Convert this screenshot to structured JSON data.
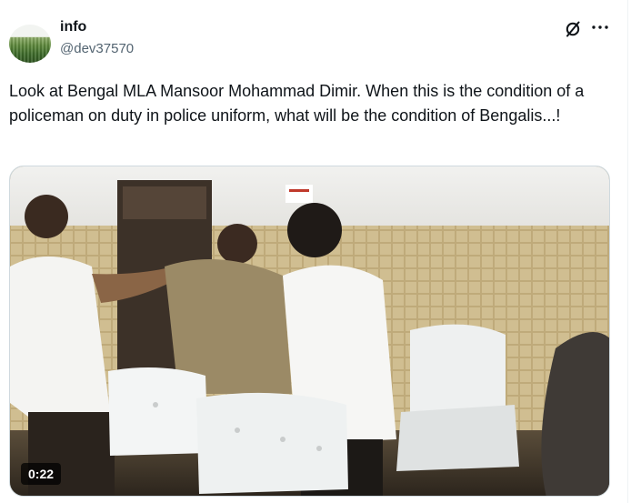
{
  "post": {
    "author": {
      "name": "info",
      "handle": "@dev37570",
      "avatar_icon": "profile-photo-field"
    },
    "header_icons": [
      "grok-icon",
      "more-icon"
    ],
    "text": "Look at Bengal MLA Mansoor Mohammad Dimir. When this is the condition of a policeman on duty in police uniform, what will be the condition of Bengalis...!",
    "media": {
      "kind": "video",
      "duration": "0:22",
      "scene": "men-scuffle-in-office-with-white-chairs"
    }
  },
  "colors": {
    "text_primary": "#0f1419",
    "text_secondary": "#536471",
    "border": "#cfd9de"
  }
}
